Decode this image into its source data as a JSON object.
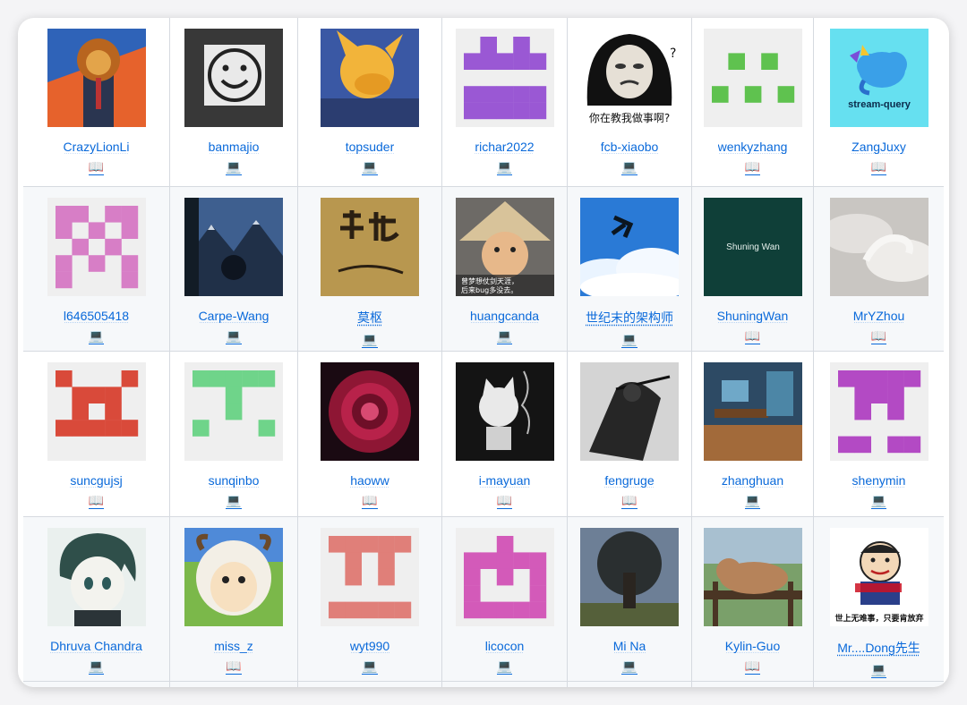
{
  "contributors": [
    {
      "name": "CrazyLionLi",
      "icon": "book-icon",
      "glyph": "📖",
      "avatar": "lion-photo"
    },
    {
      "name": "banmajio",
      "icon": "laptop-icon",
      "glyph": "💻",
      "avatar": "smiley-photo"
    },
    {
      "name": "topsuder",
      "icon": "laptop-icon",
      "glyph": "💻",
      "avatar": "cat-illustration"
    },
    {
      "name": "richar2022",
      "icon": "laptop-icon",
      "glyph": "💻",
      "avatar": "identicon-purple"
    },
    {
      "name": "fcb-xiaobo",
      "icon": "laptop-icon",
      "glyph": "💻",
      "avatar": "meme-face",
      "caption": "你在教我做事啊?"
    },
    {
      "name": "wenkyzhang",
      "icon": "book-icon",
      "glyph": "📖",
      "avatar": "identicon-green-dots"
    },
    {
      "name": "ZangJuxy",
      "icon": "book-icon",
      "glyph": "📖",
      "avatar": "stream-query-logo",
      "caption": "stream-query"
    },
    {
      "name": "l646505418",
      "icon": "laptop-icon",
      "glyph": "💻",
      "avatar": "identicon-pink"
    },
    {
      "name": "Carpe-Wang",
      "icon": "laptop-icon",
      "glyph": "💻",
      "avatar": "mountain-photo"
    },
    {
      "name": "莫枢",
      "icon": "laptop-icon",
      "glyph": "💻",
      "avatar": "calligraphy"
    },
    {
      "name": "huangcanda",
      "icon": "laptop-icon",
      "glyph": "💻",
      "avatar": "shiba-photo",
      "caption": "曾梦想仗剑天涯，后来bug多没去。"
    },
    {
      "name": "世纪末的架构师",
      "icon": "laptop-icon",
      "glyph": "💻",
      "avatar": "sky-jump"
    },
    {
      "name": "ShuningWan",
      "icon": "book-icon",
      "glyph": "📖",
      "avatar": "text-tile",
      "caption": "Shuning Wan"
    },
    {
      "name": "MrYZhou",
      "icon": "book-icon",
      "glyph": "📖",
      "avatar": "cloud-horse"
    },
    {
      "name": "suncgujsj",
      "icon": "book-icon",
      "glyph": "📖",
      "avatar": "identicon-red"
    },
    {
      "name": "sunqinbo",
      "icon": "laptop-icon",
      "glyph": "💻",
      "avatar": "identicon-green"
    },
    {
      "name": "haoww",
      "icon": "book-icon",
      "glyph": "📖",
      "avatar": "rose-photo"
    },
    {
      "name": "i-mayuan",
      "icon": "book-icon",
      "glyph": "📖",
      "avatar": "dark-cat"
    },
    {
      "name": "fengruge",
      "icon": "book-icon",
      "glyph": "📖",
      "avatar": "ink-warrior"
    },
    {
      "name": "zhanghuan",
      "icon": "laptop-icon",
      "glyph": "💻",
      "avatar": "room-illustration"
    },
    {
      "name": "shenymin",
      "icon": "laptop-icon",
      "glyph": "💻",
      "avatar": "identicon-magenta"
    },
    {
      "name": "Dhruva Chandra",
      "icon": "laptop-icon",
      "glyph": "💻",
      "avatar": "anime-boy"
    },
    {
      "name": "miss_z",
      "icon": "book-icon",
      "glyph": "📖",
      "avatar": "sheep-cartoon"
    },
    {
      "name": "wyt990",
      "icon": "laptop-icon",
      "glyph": "💻",
      "avatar": "identicon-salmon"
    },
    {
      "name": "licocon",
      "icon": "laptop-icon",
      "glyph": "💻",
      "avatar": "identicon-pink-cross"
    },
    {
      "name": "Mi Na",
      "icon": "laptop-icon",
      "glyph": "💻",
      "avatar": "tree-face"
    },
    {
      "name": "Kylin-Guo",
      "icon": "book-icon",
      "glyph": "📖",
      "avatar": "cat-fence"
    },
    {
      "name": "Mr....Dong先生",
      "icon": "laptop-icon",
      "glyph": "💻",
      "avatar": "meme-man",
      "caption": "世上无难事，只要肯放弃"
    }
  ]
}
